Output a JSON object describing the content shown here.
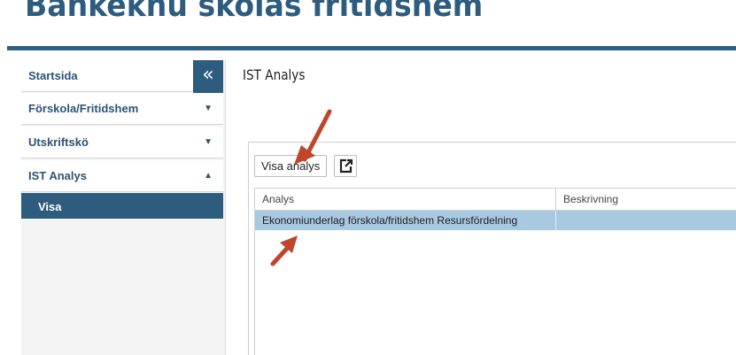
{
  "header": {
    "title": "Bankeknu skolas fritidshem"
  },
  "sidebar": {
    "collapse_symbol": "«",
    "items": [
      {
        "label": "Startsida"
      },
      {
        "label": "Förskola/Fritidshem",
        "caret": "▼"
      },
      {
        "label": "Utskriftskö",
        "caret": "▼"
      },
      {
        "label": "IST Analys",
        "caret": "▲"
      }
    ],
    "active_sub_item": "Visa"
  },
  "main": {
    "title": "IST Analys",
    "toolbar": {
      "show_button": "Visa analys",
      "export_icon": "external-link-icon"
    },
    "table": {
      "columns": [
        "Analys",
        "Beskrivning"
      ],
      "rows": [
        {
          "analys": "Ekonomiunderlag förskola/fritidshem Resursfördelning",
          "beskrivning": ""
        }
      ]
    }
  },
  "colors": {
    "brand": "#2d5c7f",
    "selected_row": "#a8c9e2",
    "annotation_arrow": "#c0452b"
  }
}
